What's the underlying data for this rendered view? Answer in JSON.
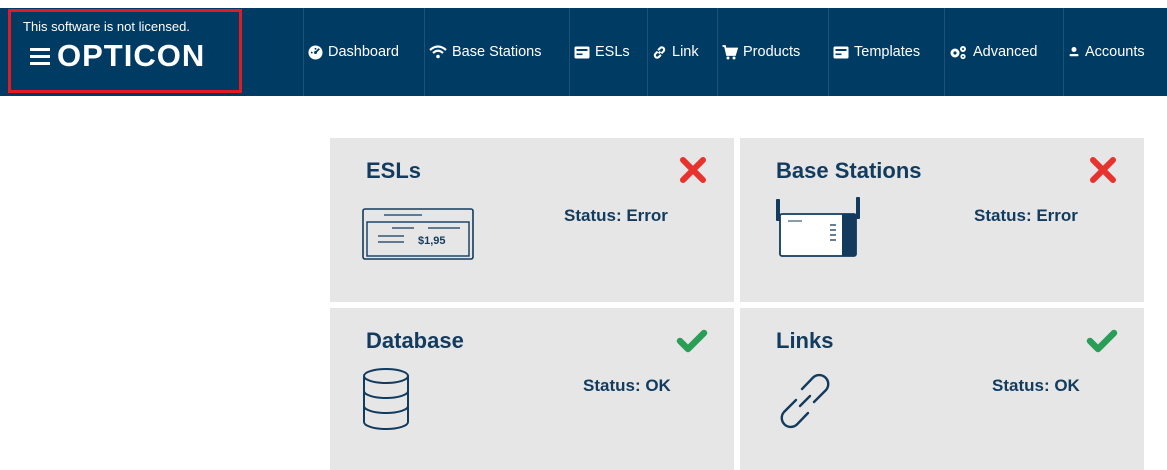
{
  "header": {
    "license_notice": "This software is not licensed.",
    "brand": "OPTICON",
    "nav": [
      {
        "label": "Dashboard",
        "icon": "dashboard-icon"
      },
      {
        "label": "Base Stations",
        "icon": "wifi-icon"
      },
      {
        "label": "ESLs",
        "icon": "card-icon"
      },
      {
        "label": "Link",
        "icon": "link-icon"
      },
      {
        "label": "Products",
        "icon": "cart-icon"
      },
      {
        "label": "Templates",
        "icon": "template-icon"
      },
      {
        "label": "Advanced",
        "icon": "gears-icon"
      },
      {
        "label": "Accounts",
        "icon": "user-icon"
      }
    ]
  },
  "cards": [
    {
      "title": "ESLs",
      "status": "Status: Error",
      "state": "error",
      "icon": "esl-label-icon",
      "price_text": "$1,95"
    },
    {
      "title": "Base Stations",
      "status": "Status: Error",
      "state": "error",
      "icon": "base-station-icon"
    },
    {
      "title": "Database",
      "status": "Status: OK",
      "state": "ok",
      "icon": "database-icon"
    },
    {
      "title": "Links",
      "status": "Status: OK",
      "state": "ok",
      "icon": "link-icon"
    }
  ],
  "colors": {
    "navbar": "#003b63",
    "card_bg": "#e6e6e6",
    "title_text": "#123b5e",
    "error": "#e8322e",
    "ok": "#2a9d57",
    "highlight_border": "#e01b24"
  }
}
